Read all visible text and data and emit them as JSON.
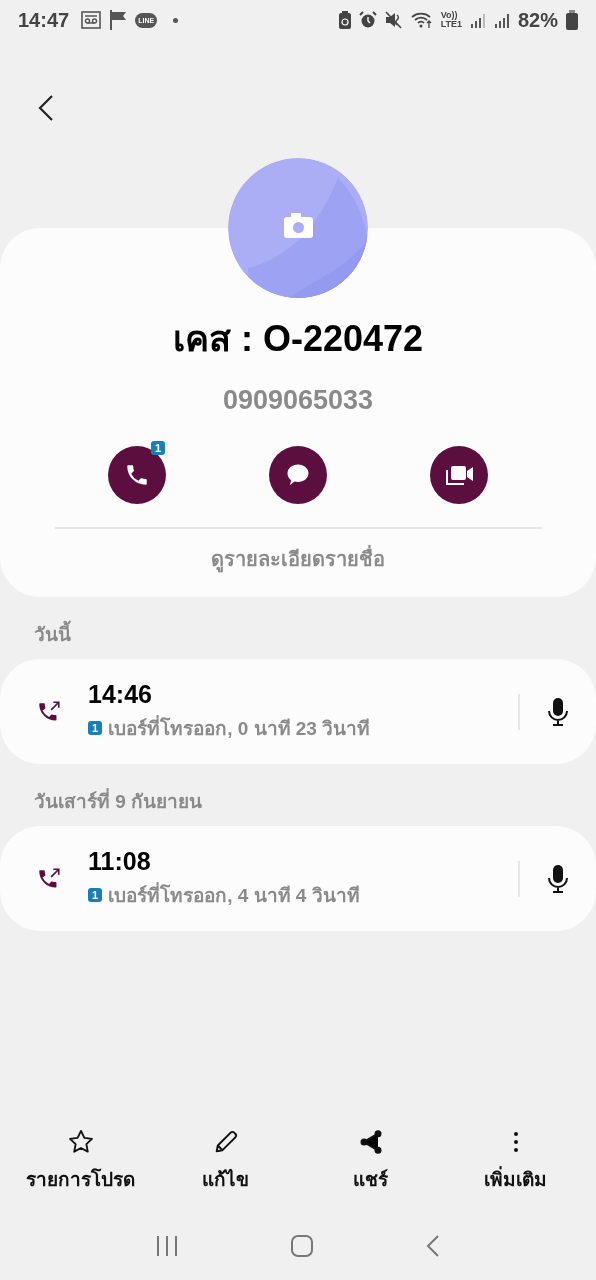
{
  "status_bar": {
    "time": "14:47",
    "app_badge": "LINE",
    "network_top": "Vo))",
    "network_bottom": "LTE1",
    "battery": "82%"
  },
  "contact": {
    "name": "เคส : O-220472",
    "phone": "0909065033",
    "actions": [
      {
        "kind": "call",
        "badge": "1"
      },
      {
        "kind": "message"
      },
      {
        "kind": "video"
      }
    ],
    "details_link": "ดูรายละเอียดรายชื่อ"
  },
  "call_log": [
    {
      "date": "วันนี้",
      "calls": [
        {
          "time": "14:46",
          "sim": "1",
          "description": "เบอร์ที่โทรออก, 0 นาที 23 วินาที"
        }
      ]
    },
    {
      "date": "วันเสาร์ที่ 9 กันยายน",
      "calls": [
        {
          "time": "11:08",
          "sim": "1",
          "description": "เบอร์ที่โทรออก, 4 นาที 4 วินาที"
        }
      ]
    }
  ],
  "bottom_actions": [
    {
      "kind": "favorite",
      "label": "รายการโปรด"
    },
    {
      "kind": "edit",
      "label": "แก้ไข"
    },
    {
      "kind": "share",
      "label": "แชร์"
    },
    {
      "kind": "more",
      "label": "เพิ่มเติม"
    }
  ]
}
